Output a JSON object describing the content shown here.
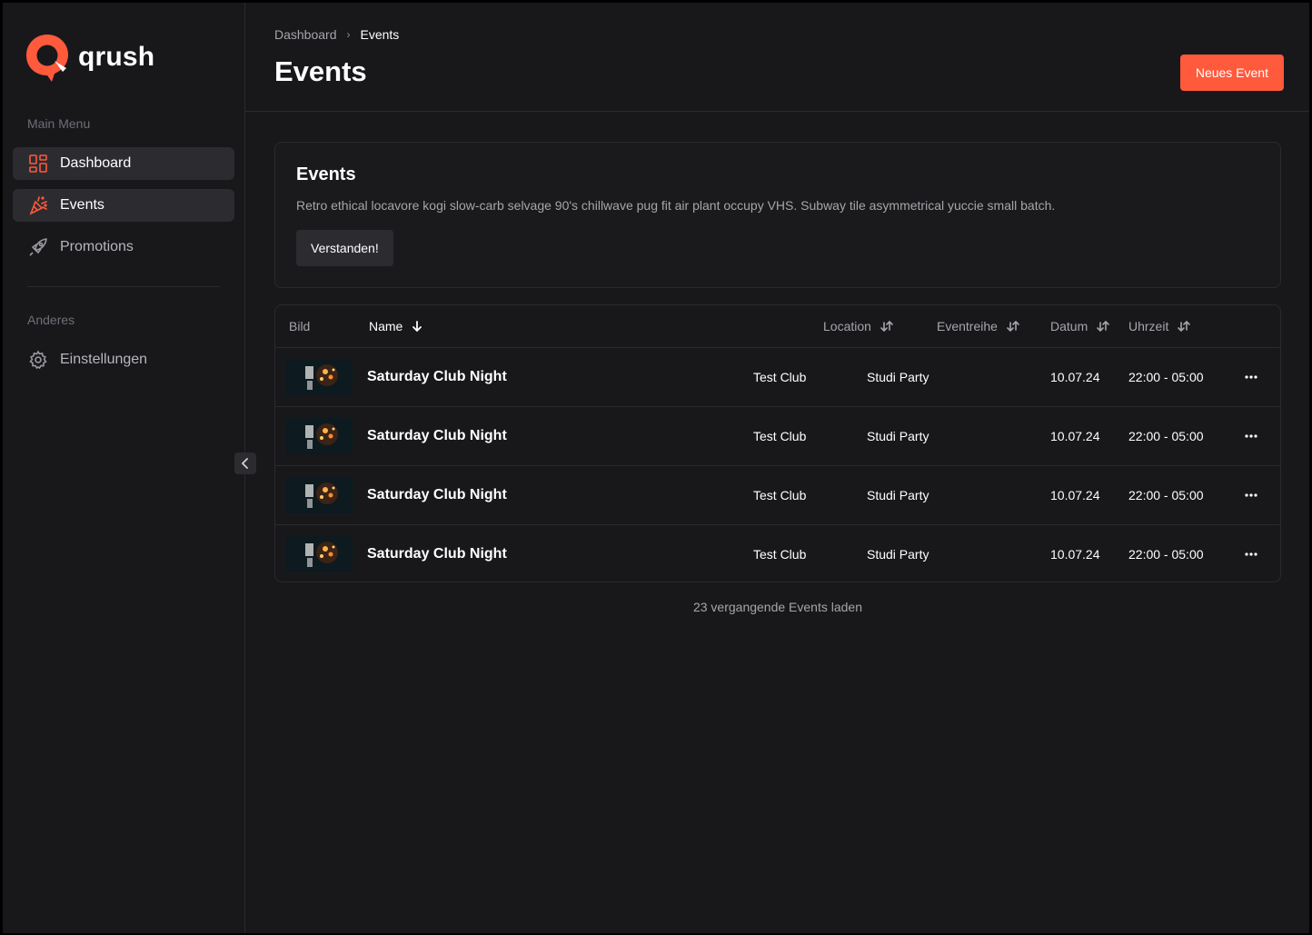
{
  "brand": {
    "name": "qrush",
    "accent": "#ff5a3c"
  },
  "sidebar": {
    "main_menu_label": "Main Menu",
    "items": [
      {
        "label": "Dashboard",
        "icon": "dashboard-icon"
      },
      {
        "label": "Events",
        "icon": "party-popper-icon"
      },
      {
        "label": "Promotions",
        "icon": "rocket-icon"
      }
    ],
    "other_label": "Anderes",
    "other_items": [
      {
        "label": "Einstellungen",
        "icon": "gear-icon"
      }
    ]
  },
  "breadcrumb": {
    "parent": "Dashboard",
    "current": "Events"
  },
  "page": {
    "title": "Events",
    "new_button": "Neues Event"
  },
  "info_card": {
    "title": "Events",
    "text": "Retro ethical locavore kogi slow-carb selvage 90's chillwave pug fit air  plant occupy VHS.  Subway tile asymmetrical yuccie small batch.",
    "button": "Verstanden!"
  },
  "table": {
    "columns": {
      "image": "Bild",
      "name": "Name",
      "location": "Location",
      "series": "Eventreihe",
      "date": "Datum",
      "time": "Uhrzeit"
    },
    "rows": [
      {
        "name": "Saturday Club Night",
        "location": "Test Club",
        "series": "Studi Party",
        "date": "10.07.24",
        "time": "22:00 - 05:00"
      },
      {
        "name": "Saturday Club Night",
        "location": "Test Club",
        "series": "Studi Party",
        "date": "10.07.24",
        "time": "22:00 - 05:00"
      },
      {
        "name": "Saturday Club Night",
        "location": "Test Club",
        "series": "Studi Party",
        "date": "10.07.24",
        "time": "22:00 - 05:00"
      },
      {
        "name": "Saturday Club Night",
        "location": "Test Club",
        "series": "Studi Party",
        "date": "10.07.24",
        "time": "22:00 - 05:00"
      }
    ]
  },
  "load_more": "23 vergangende Events laden"
}
